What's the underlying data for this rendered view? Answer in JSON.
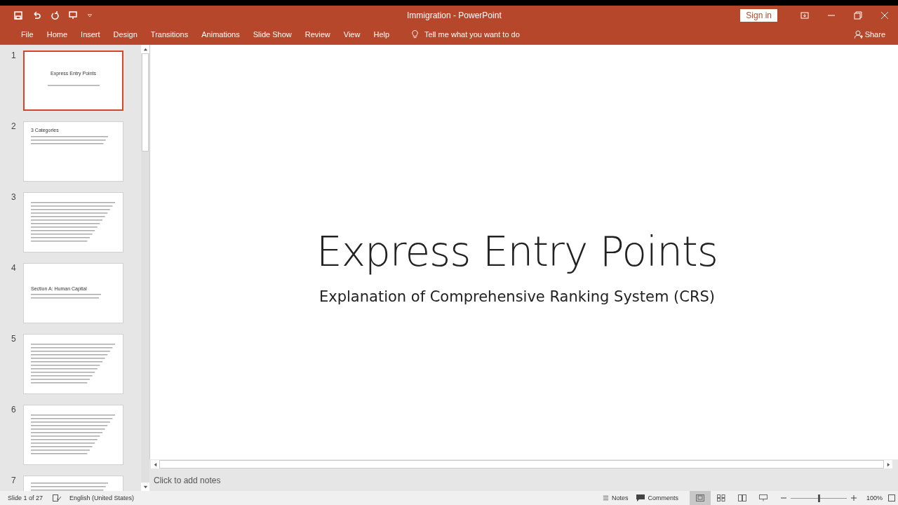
{
  "window": {
    "title": "Immigration  -  PowerPoint",
    "sign_in": "Sign in"
  },
  "ribbon_tabs": [
    {
      "label": "File"
    },
    {
      "label": "Home"
    },
    {
      "label": "Insert"
    },
    {
      "label": "Design"
    },
    {
      "label": "Transitions"
    },
    {
      "label": "Animations"
    },
    {
      "label": "Slide Show"
    },
    {
      "label": "Review"
    },
    {
      "label": "View"
    },
    {
      "label": "Help"
    }
  ],
  "tell_me": "Tell me what you want to do",
  "share": "Share",
  "thumbnails": [
    {
      "number": "1",
      "selected": true,
      "kind": "title",
      "title": "Express Entry Points"
    },
    {
      "number": "2",
      "selected": false,
      "kind": "bullets",
      "title": "3 Categories"
    },
    {
      "number": "3",
      "selected": false,
      "kind": "table"
    },
    {
      "number": "4",
      "selected": false,
      "kind": "section",
      "title": "Section A: Human Capital"
    },
    {
      "number": "5",
      "selected": false,
      "kind": "table"
    },
    {
      "number": "6",
      "selected": false,
      "kind": "table"
    },
    {
      "number": "7",
      "selected": false,
      "kind": "bullets"
    }
  ],
  "slide": {
    "title": "Express Entry Points",
    "subtitle": "Explanation of Comprehensive Ranking System (CRS)"
  },
  "notes": {
    "placeholder": "Click to add notes"
  },
  "status_bar": {
    "slide_count": "Slide 1 of 27",
    "language": "English (United States)",
    "notes": "Notes",
    "comments": "Comments",
    "views": [
      {
        "selected": true
      },
      {
        "selected": false
      },
      {
        "selected": false
      },
      {
        "selected": false
      }
    ],
    "zoom": {
      "level": 0.5,
      "label": "100%"
    }
  }
}
